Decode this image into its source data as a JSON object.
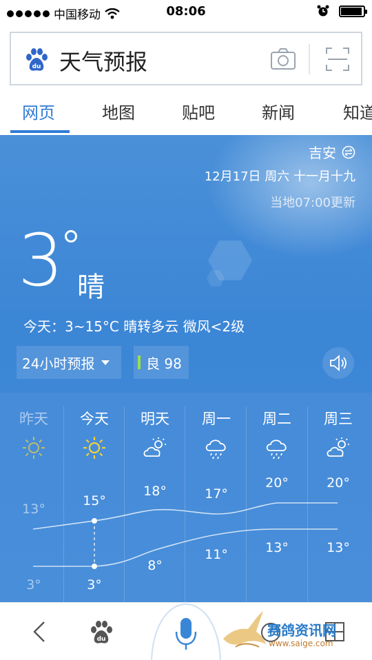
{
  "status_bar": {
    "carrier": "中国移动",
    "time": "08:06"
  },
  "search": {
    "query": "天气预报"
  },
  "tabs": [
    {
      "label": "网页",
      "active": true
    },
    {
      "label": "地图",
      "active": false
    },
    {
      "label": "贴吧",
      "active": false
    },
    {
      "label": "新闻",
      "active": false
    },
    {
      "label": "知道",
      "active": false
    }
  ],
  "weather": {
    "city": "吉安",
    "date": "12月17日 周六 十一月十九",
    "updated": "当地07:00更新",
    "temperature": "3",
    "condition": "晴",
    "summary": "今天：3~15°C  晴转多云  微风<2级",
    "forecast_button": "24小时预报",
    "aqi_label": "良 98",
    "aqi_color": "#9be04a",
    "days": [
      {
        "name": "昨天",
        "icon": "sun-icon",
        "high": "13°",
        "low": "3°",
        "past": true
      },
      {
        "name": "今天",
        "icon": "sun-icon",
        "high": "15°",
        "low": "3°",
        "past": false
      },
      {
        "name": "明天",
        "icon": "partly-cloudy-icon",
        "high": "18°",
        "low": "8°",
        "past": false
      },
      {
        "name": "周一",
        "icon": "rain-cloud-icon",
        "high": "17°",
        "low": "11°",
        "past": false
      },
      {
        "name": "周二",
        "icon": "rain-cloud-icon",
        "high": "20°",
        "low": "13°",
        "past": false
      },
      {
        "name": "周三",
        "icon": "partly-cloudy-icon",
        "high": "20°",
        "low": "13°",
        "past": false
      }
    ]
  },
  "watermark": {
    "text": "赛鸽资讯网",
    "url": "www.saige.com"
  },
  "colors": {
    "accent": "#2f7bd6",
    "weather_bg": "#3c86d6",
    "sun": "#f2d23a"
  }
}
